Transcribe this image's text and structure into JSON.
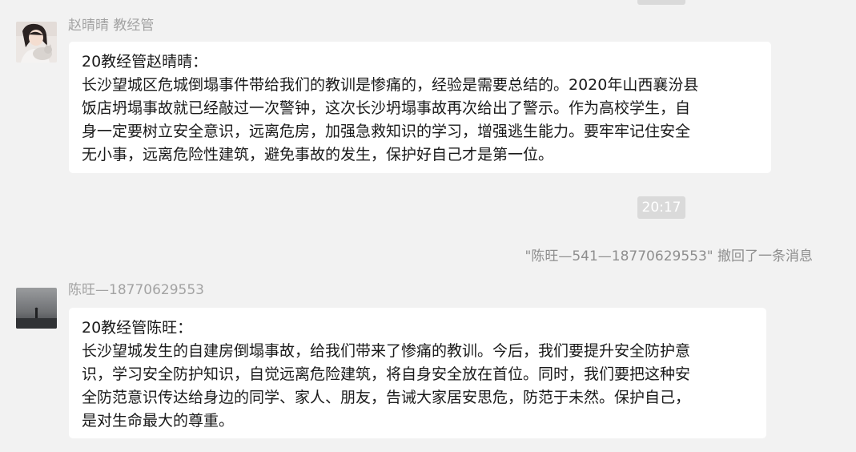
{
  "messages": [
    {
      "sender": "赵晴晴 教经管",
      "avatar_icon": "user-avatar-girl-with-cat",
      "lines": [
        "20教经管赵晴晴：",
        "长沙望城区危城倒塌事件带给我们的教训是惨痛的，经验是需要总结的。2020年山西襄汾县",
        "饭店坍塌事故就已经敲过一次警钟，这次长沙坍塌事故再次给出了警示。作为高校学生，自",
        "身一定要树立安全意识，远离危房，加强急救知识的学习，增强逃生能力。要牢牢记住安全",
        "无小事，远离危险性建筑，避免事故的发生，保护好自己才是第一位。"
      ]
    },
    {
      "sender": "陈旺—18770629553",
      "avatar_icon": "user-avatar-foggy-silhouette",
      "lines": [
        "20教经管陈旺：",
        "长沙望城发生的自建房倒塌事故，给我们带来了惨痛的教训。今后，我们要提升安全防护意",
        "识，学习安全防护知识，自觉远离危险建筑，将自身安全放在首位。同时，我们要把这种安",
        "全防范意识传达给身边的同学、家人、朋友，告诫大家居安思危，防范于未然。保护自己，",
        "是对生命最大的尊重。"
      ]
    }
  ],
  "time_label": "20:17",
  "system_notice": "\"陈旺—541—18770629553\" 撤回了一条消息",
  "colors": {
    "background": "#f2f2f2",
    "bubble": "#ffffff",
    "time_chip": "#dadada",
    "sender_text": "#a3a3a3",
    "message_text": "#1a1a1a"
  }
}
